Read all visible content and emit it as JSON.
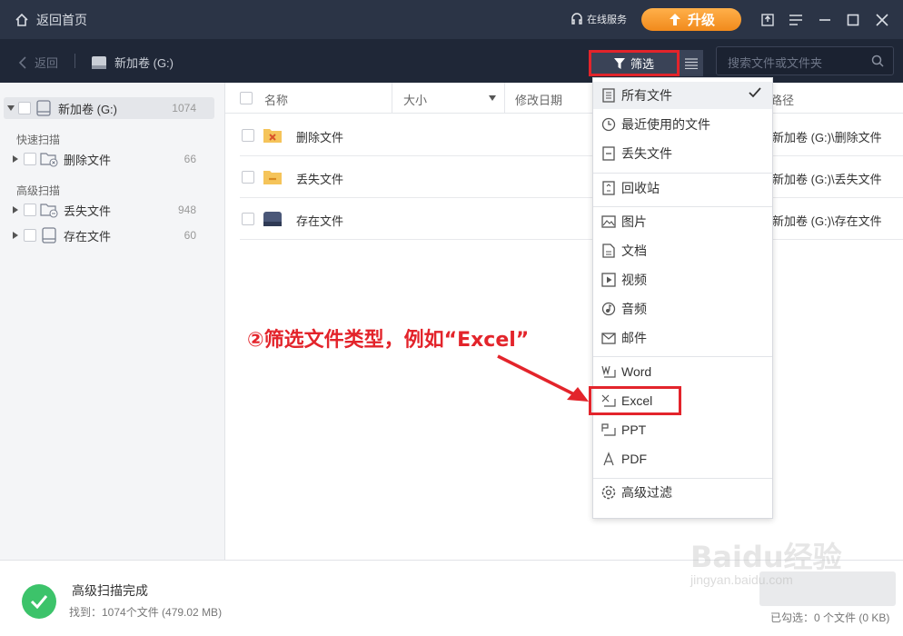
{
  "titlebar": {
    "home_label": "返回首页",
    "service_label": "在线服务",
    "upgrade_label": "升级"
  },
  "toolbar": {
    "back_label": "返回",
    "drive_label": "新加卷 (G:)",
    "filter_label": "筛选",
    "search_placeholder": "搜索文件或文件夹"
  },
  "sidebar": {
    "root": {
      "label": "新加卷 (G:)",
      "count": "1074"
    },
    "quick_scan_label": "快速扫描",
    "deep_scan_label": "高级扫描",
    "items": [
      {
        "label": "删除文件",
        "count": "66"
      },
      {
        "label": "丢失文件",
        "count": "948"
      },
      {
        "label": "存在文件",
        "count": "60"
      }
    ]
  },
  "table": {
    "headers": {
      "name": "名称",
      "size": "大小",
      "modified": "修改日期",
      "path": "路径"
    },
    "rows": [
      {
        "name": "删除文件",
        "path": "新加卷 (G:)\\删除文件"
      },
      {
        "name": "丢失文件",
        "path": "新加卷 (G:)\\丢失文件"
      },
      {
        "name": "存在文件",
        "path": "新加卷 (G:)\\存在文件"
      }
    ]
  },
  "menu": {
    "items": [
      {
        "label": "所有文件",
        "icon": "all-files-icon",
        "selected": true
      },
      {
        "label": "最近使用的文件",
        "icon": "clock-icon"
      },
      {
        "label": "丢失文件",
        "icon": "lost-file-icon"
      },
      {
        "label": "回收站",
        "icon": "recycle-bin-icon"
      },
      {
        "label": "图片",
        "icon": "image-icon"
      },
      {
        "label": "文档",
        "icon": "document-icon"
      },
      {
        "label": "视频",
        "icon": "video-icon"
      },
      {
        "label": "音频",
        "icon": "audio-icon"
      },
      {
        "label": "邮件",
        "icon": "mail-icon"
      },
      {
        "label": "Word",
        "icon": "word-icon"
      },
      {
        "label": "Excel",
        "icon": "excel-icon"
      },
      {
        "label": "PPT",
        "icon": "ppt-icon"
      },
      {
        "label": "PDF",
        "icon": "pdf-icon"
      },
      {
        "label": "高级过滤",
        "icon": "advanced-filter-icon"
      }
    ]
  },
  "annotation": {
    "text": "②筛选文件类型，例如“Excel”"
  },
  "status": {
    "title": "高级扫描完成",
    "found": "找到：1074个文件 (479.02 MB)",
    "selected": "已勾选：0 个文件 (0 KB)"
  },
  "watermark": {
    "brand": "Baidu经验",
    "url": "jingyan.baidu.com"
  },
  "colors": {
    "titlebar_bg": "#2b3446",
    "toolbar_bg": "#1f2737",
    "accent_orange": "#f18a1c",
    "annotation_red": "#e3242b",
    "success_green": "#3cc36a"
  }
}
